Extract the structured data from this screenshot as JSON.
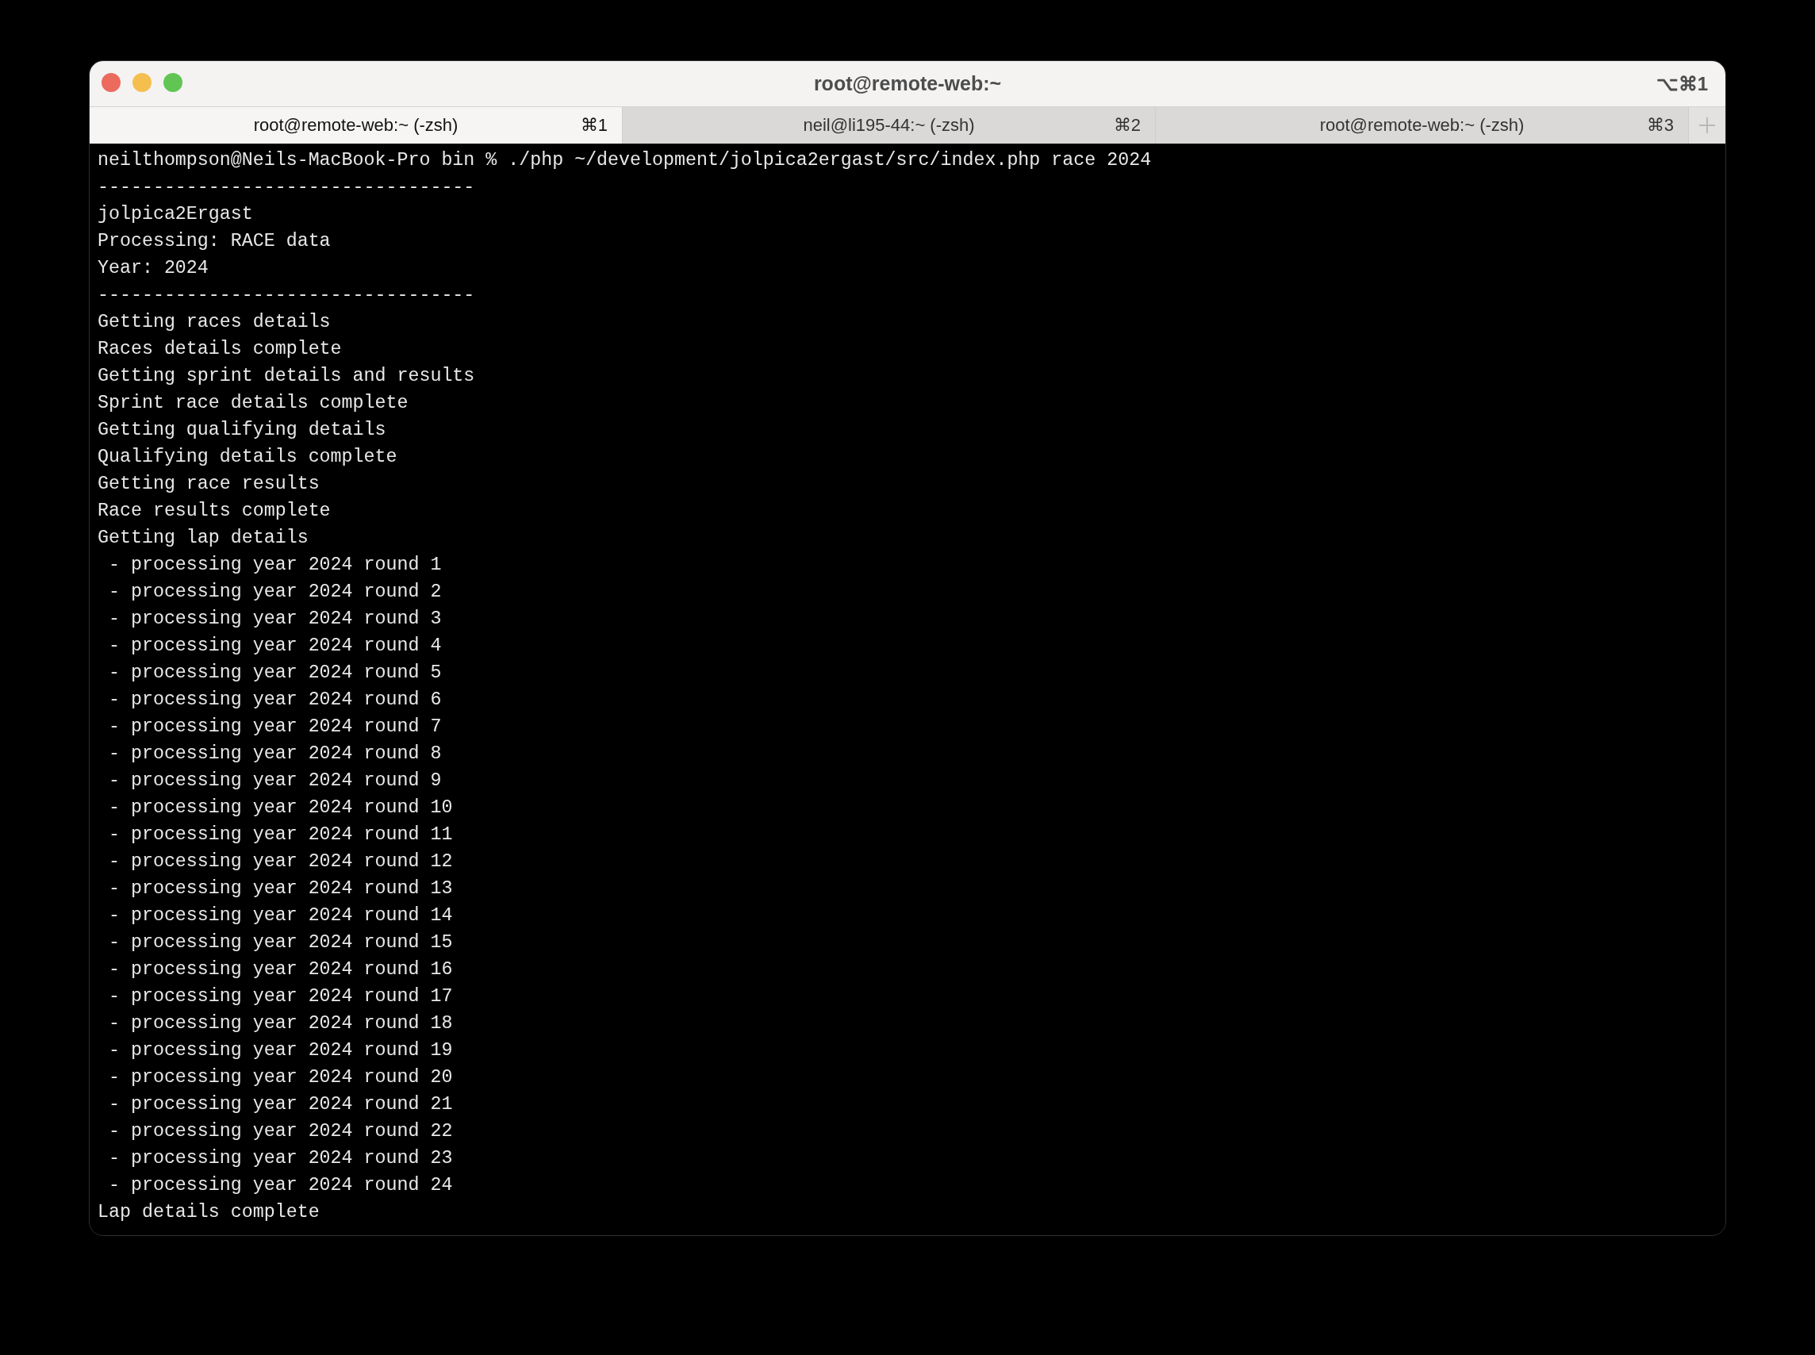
{
  "window": {
    "title": "root@remote-web:~",
    "shortcut": "⌥⌘1"
  },
  "tabs": [
    {
      "label": "root@remote-web:~ (-zsh)",
      "shortcut": "⌘1",
      "selected": true
    },
    {
      "label": "neil@li195-44:~ (-zsh)",
      "shortcut": "⌘2",
      "selected": false
    },
    {
      "label": "root@remote-web:~ (-zsh)",
      "shortcut": "⌘3",
      "selected": false
    }
  ],
  "terminal": {
    "lines": [
      "neilthompson@Neils-MacBook-Pro bin % ./php ~/development/jolpica2ergast/src/index.php race 2024",
      "----------------------------------",
      "jolpica2Ergast",
      "Processing: RACE data",
      "Year: 2024",
      "----------------------------------",
      "Getting races details",
      "Races details complete",
      "Getting sprint details and results",
      "Sprint race details complete",
      "Getting qualifying details",
      "Qualifying details complete",
      "Getting race results",
      "Race results complete",
      "Getting lap details",
      " - processing year 2024 round 1",
      " - processing year 2024 round 2",
      " - processing year 2024 round 3",
      " - processing year 2024 round 4",
      " - processing year 2024 round 5",
      " - processing year 2024 round 6",
      " - processing year 2024 round 7",
      " - processing year 2024 round 8",
      " - processing year 2024 round 9",
      " - processing year 2024 round 10",
      " - processing year 2024 round 11",
      " - processing year 2024 round 12",
      " - processing year 2024 round 13",
      " - processing year 2024 round 14",
      " - processing year 2024 round 15",
      " - processing year 2024 round 16",
      " - processing year 2024 round 17",
      " - processing year 2024 round 18",
      " - processing year 2024 round 19",
      " - processing year 2024 round 20",
      " - processing year 2024 round 21",
      " - processing year 2024 round 22",
      " - processing year 2024 round 23",
      " - processing year 2024 round 24",
      "Lap details complete"
    ]
  }
}
